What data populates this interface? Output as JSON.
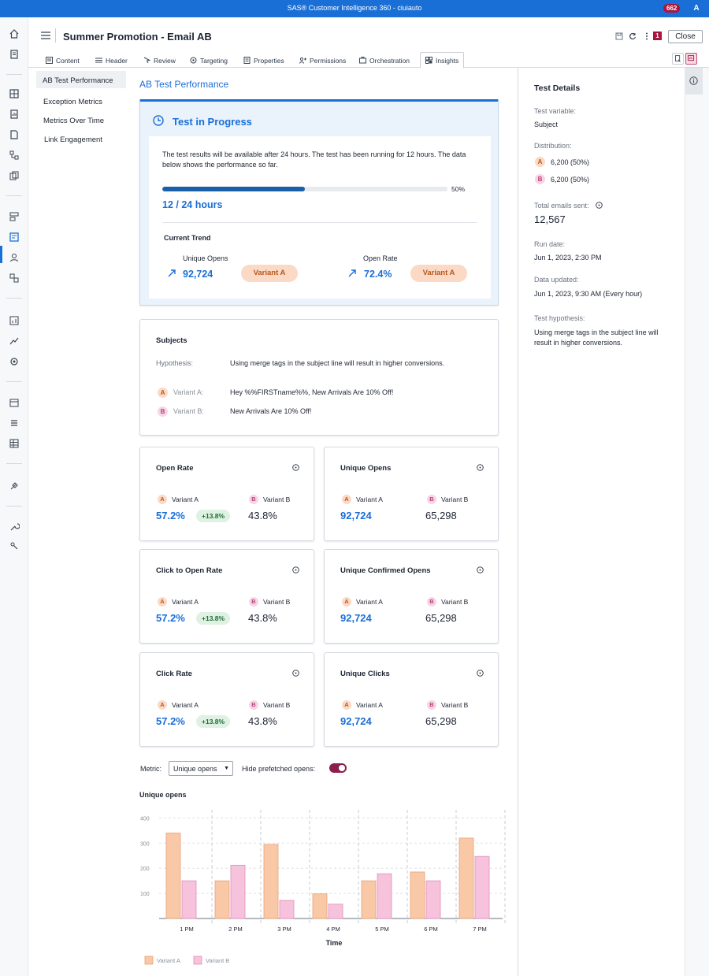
{
  "topbar": {
    "app_title": "SAS® Customer Intelligence 360 - ciuiauto",
    "notification_count": "662",
    "avatar_initial": "A"
  },
  "header": {
    "title": "Summer Promotion - Email AB",
    "flag_count": "1",
    "close_label": "Close"
  },
  "tabs": [
    {
      "label": "Content",
      "icon": "content-icon"
    },
    {
      "label": "Header",
      "icon": "list-icon"
    },
    {
      "label": "Review",
      "icon": "review-icon"
    },
    {
      "label": "Targeting",
      "icon": "target-icon"
    },
    {
      "label": "Properties",
      "icon": "properties-icon"
    },
    {
      "label": "Permissions",
      "icon": "permissions-icon"
    },
    {
      "label": "Orchestration",
      "icon": "orchestration-icon"
    },
    {
      "label": "Insights",
      "icon": "insights-icon",
      "active": true
    }
  ],
  "subnav": {
    "items": [
      "AB Test Performance",
      "Exception Metrics",
      "Metrics Over Time",
      "Link Engagement"
    ]
  },
  "main": {
    "section_title": "AB Test Performance",
    "progress": {
      "title": "Test in Progress",
      "description": "The test results will be available after 24 hours. The test has been running for 12 hours. The data below shows the performance so far.",
      "percent": 50,
      "percent_label": "50%",
      "hours_label": "12 / 24 hours",
      "trend_title": "Current Trend",
      "trends": [
        {
          "label": "Unique Opens",
          "value": "92,724",
          "winner": "Variant A"
        },
        {
          "label": "Open Rate",
          "value": "72.4%",
          "winner": "Variant A"
        }
      ]
    },
    "subjects": {
      "title": "Subjects",
      "hypothesis_label": "Hypothesis:",
      "hypothesis": "Using merge tags in the subject line will result in higher conversions.",
      "variants": [
        {
          "badge": "A",
          "label": "Variant A:",
          "text": "Hey %%FIRSTname%%, New Arrivals Are 10% Off!"
        },
        {
          "badge": "B",
          "label": "Variant B:",
          "text": "New Arrivals Are 10% Off!"
        }
      ]
    },
    "metrics": [
      {
        "title": "Open Rate",
        "a_label": "Variant A",
        "b_label": "Variant B",
        "a_value": "57.2%",
        "lift": "+13.8%",
        "b_value": "43.8%"
      },
      {
        "title": "Unique Opens",
        "a_label": "Variant A",
        "b_label": "Variant B",
        "a_value": "92,724",
        "lift": "",
        "b_value": "65,298"
      },
      {
        "title": "Click to Open Rate",
        "a_label": "Variant A",
        "b_label": "Variant B",
        "a_value": "57.2%",
        "lift": "+13.8%",
        "b_value": "43.8%"
      },
      {
        "title": "Unique Confirmed Opens",
        "a_label": "Variant A",
        "b_label": "Variant B",
        "a_value": "92,724",
        "lift": "",
        "b_value": "65,298"
      },
      {
        "title": "Click Rate",
        "a_label": "Variant A",
        "b_label": "Variant B",
        "a_value": "57.2%",
        "lift": "+13.8%",
        "b_value": "43.8%"
      },
      {
        "title": "Unique Clicks",
        "a_label": "Variant A",
        "b_label": "Variant B",
        "a_value": "92,724",
        "lift": "",
        "b_value": "65,298"
      }
    ],
    "filter": {
      "metric_label": "Metric:",
      "metric_value": "Unique opens",
      "hide_label": "Hide prefetched opens:",
      "hide_on": true
    },
    "chart_title": "Unique opens"
  },
  "chart_data": {
    "type": "bar",
    "title": "Unique opens",
    "xlabel": "Time",
    "ylabel": "",
    "categories": [
      "1 PM",
      "2 PM",
      "3 PM",
      "4 PM",
      "5 PM",
      "6 PM",
      "7 PM"
    ],
    "series": [
      {
        "name": "Variant A",
        "values": [
          340,
          150,
          295,
          98,
          150,
          185,
          320
        ],
        "color": "#f9c8a6"
      },
      {
        "name": "Variant B",
        "values": [
          150,
          212,
          72,
          57,
          178,
          150,
          247
        ],
        "color": "#f7c2dc"
      }
    ],
    "yticks": [
      100,
      200,
      300,
      400
    ],
    "ylim": [
      0,
      420
    ],
    "grid": true,
    "legend": "bottom-left"
  },
  "details": {
    "title": "Test Details",
    "test_variable_label": "Test variable:",
    "test_variable": "Subject",
    "distribution_label": "Distribution:",
    "distribution": [
      {
        "badge": "A",
        "text": "6,200 (50%)"
      },
      {
        "badge": "B",
        "text": "6,200 (50%)"
      }
    ],
    "total_label": "Total emails sent:",
    "total": "12,567",
    "run_date_label": "Run date:",
    "run_date": "Jun 1, 2023, 2:30 PM",
    "data_updated_label": "Data updated:",
    "data_updated": "Jun 1, 2023, 9:30 AM (Every hour)",
    "hypothesis_label": "Test hypothesis:",
    "hypothesis": "Using merge tags in the subject line will result in higher conversions."
  },
  "colors": {
    "accent": "#1a6fd6",
    "variant_a": "#f9c8a6",
    "variant_b": "#f7c2dc",
    "brand_red": "#a8163f"
  }
}
